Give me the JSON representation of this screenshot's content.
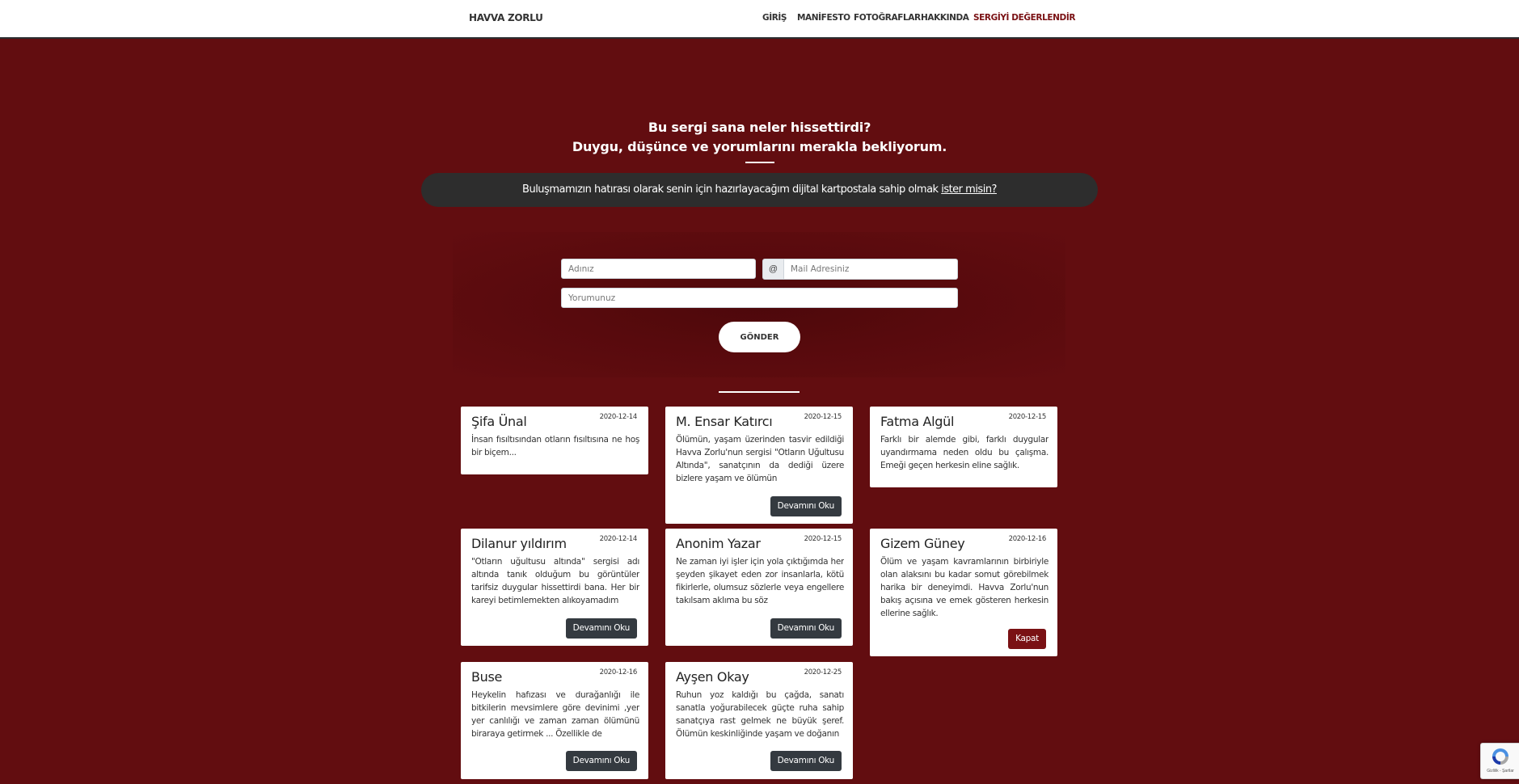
{
  "nav": {
    "brand": "HAVVA ZORLU",
    "links": [
      "GİRİŞ",
      "MANİFESTO",
      "FOTOĞRAFLAR",
      "HAKKINDA",
      "SERGİYİ DEĞERLENDİR"
    ]
  },
  "hero": {
    "line1": "Bu sergi sana neler hissettirdi?",
    "line2": "Duygu, düşünce ve yorumlarını merakla bekliyorum."
  },
  "info_bar": {
    "text": "Buluşmamızın hatırası olarak senin için hazırlayacağım dijital kartpostala sahip olmak ",
    "link": "ister misin?"
  },
  "form": {
    "name_placeholder": "Adınız",
    "at_symbol": "@",
    "email_placeholder": "Mail Adresiniz",
    "comment_placeholder": "Yorumunuz",
    "submit_label": "GÖNDER"
  },
  "comments": [
    {
      "name": "Şifa Ünal",
      "date": "2020-12-14",
      "text": "İnsan fısıltısından otların fısıltısına ne hoş bir biçem...",
      "button": ""
    },
    {
      "name": "M. Ensar Katırcı",
      "date": "2020-12-15",
      "text": "Ölümün, yaşam üzerinden tasvir edildiği Havva Zorlu'nun sergisi \"Otların Uğultusu Altında\", sanatçının da dediği üzere bizlere yaşam ve ölümün",
      "button": "Devamını Oku"
    },
    {
      "name": "Fatma Algül",
      "date": "2020-12-15",
      "text": "Farklı bir alemde gibi, farklı duygular uyandırmama neden oldu bu çalışma. Emeği geçen herkesin eline sağlık.",
      "button": ""
    },
    {
      "name": "Dilanur yıldırım",
      "date": "2020-12-14",
      "text": "\"Otların uğultusu altında\" sergisi adı altında tanık olduğum bu görüntüler tarifsiz duygular hissettirdi bana. Her bir kareyi betimlemekten alıkoyamadım",
      "button": "Devamını Oku"
    },
    {
      "name": "Anonim Yazar",
      "date": "2020-12-15",
      "text": "Ne zaman iyi işler için yola çıktığımda her şeyden şikayet eden zor insanlarla, kötü fikirlerle, olumsuz sözlerle veya engellere takılsam aklıma bu söz",
      "button": "Devamını Oku"
    },
    {
      "name": "Gizem Güney",
      "date": "2020-12-16",
      "text": "Ölüm ve yaşam kavramlarının birbiriyle olan alaksını bu kadar somut görebilmek harika bir deneyimdi. Havva Zorlu'nun bakış açısına ve emek gösteren herkesin ellerine sağlık.",
      "button": "Kapat"
    },
    {
      "name": "Buse",
      "date": "2020-12-16",
      "text": "Heykelin hafızası ve durağanlığı ile bitkilerin mevsimlere göre devinimi ,yer yer canlılığı ve zaman zaman ölümünü biraraya getirmek ... Özellikle de",
      "button": "Devamını Oku"
    },
    {
      "name": "Ayşen Okay",
      "date": "2020-12-25",
      "text": "Ruhun yoz kaldığı bu çağda, sanatı sanatla yoğurabilecek güçte ruha sahip sanatçıya rast gelmek ne büyük şeref. Ölümün keskinliğinde yaşam ve doğanın",
      "button": "Devamını Oku"
    }
  ],
  "recaptcha": {
    "text": "Gizlilik - Şartlar",
    "colors": {
      "blue": "#4a90e2",
      "grey": "#a6a6a6",
      "dark": "#1c3aa9"
    }
  },
  "colors": {
    "background": "#620d10",
    "active_nav": "#7a1114",
    "info_bar": "#2d2d2d",
    "button_dark": "#343a40",
    "button_close": "#7a1114"
  }
}
